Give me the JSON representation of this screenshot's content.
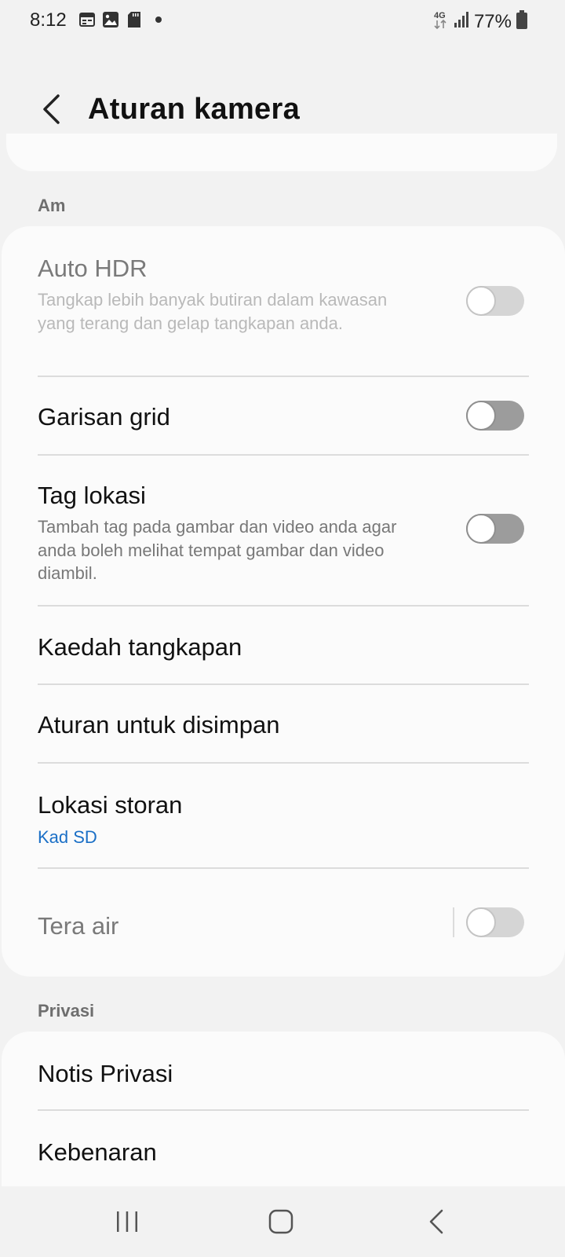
{
  "status_bar": {
    "time": "8:12",
    "network": "4G",
    "battery": "77%"
  },
  "header": {
    "title": "Aturan kamera"
  },
  "sections": {
    "general": {
      "label": "Am",
      "items": [
        {
          "title": "Auto HDR",
          "subtitle": "Tangkap lebih banyak butiran dalam kawasan yang terang dan gelap tangkapan anda.",
          "toggle": "off",
          "enabled": false
        },
        {
          "title": "Garisan grid",
          "toggle": "off",
          "enabled": true
        },
        {
          "title": "Tag lokasi",
          "subtitle": "Tambah tag pada gambar dan video anda agar anda boleh melihat tempat gambar dan video diambil.",
          "toggle": "off",
          "enabled": true
        },
        {
          "title": "Kaedah tangkapan"
        },
        {
          "title": "Aturan untuk disimpan"
        },
        {
          "title": "Lokasi storan",
          "value": "Kad SD"
        },
        {
          "title": "Tera air",
          "toggle": "off",
          "enabled": false
        }
      ]
    },
    "privacy": {
      "label": "Privasi",
      "items": [
        {
          "title": "Notis Privasi"
        },
        {
          "title": "Kebenaran"
        }
      ]
    }
  },
  "colors": {
    "background": "#f2f2f2",
    "card": "#fbfbfb",
    "accent_link": "#1a6fc6",
    "toggle_off_track": "#9c9c9c",
    "toggle_disabled_track": "#d5d5d5"
  },
  "icons": {
    "status_left": [
      "calendar-icon",
      "gallery-icon",
      "sd-card-icon",
      "notification-dot-icon"
    ],
    "status_right": [
      "network-4g-icon",
      "signal-icon",
      "battery-icon"
    ],
    "header": "back-arrow-icon",
    "nav": [
      "recent-apps-icon",
      "home-icon",
      "back-icon"
    ]
  }
}
